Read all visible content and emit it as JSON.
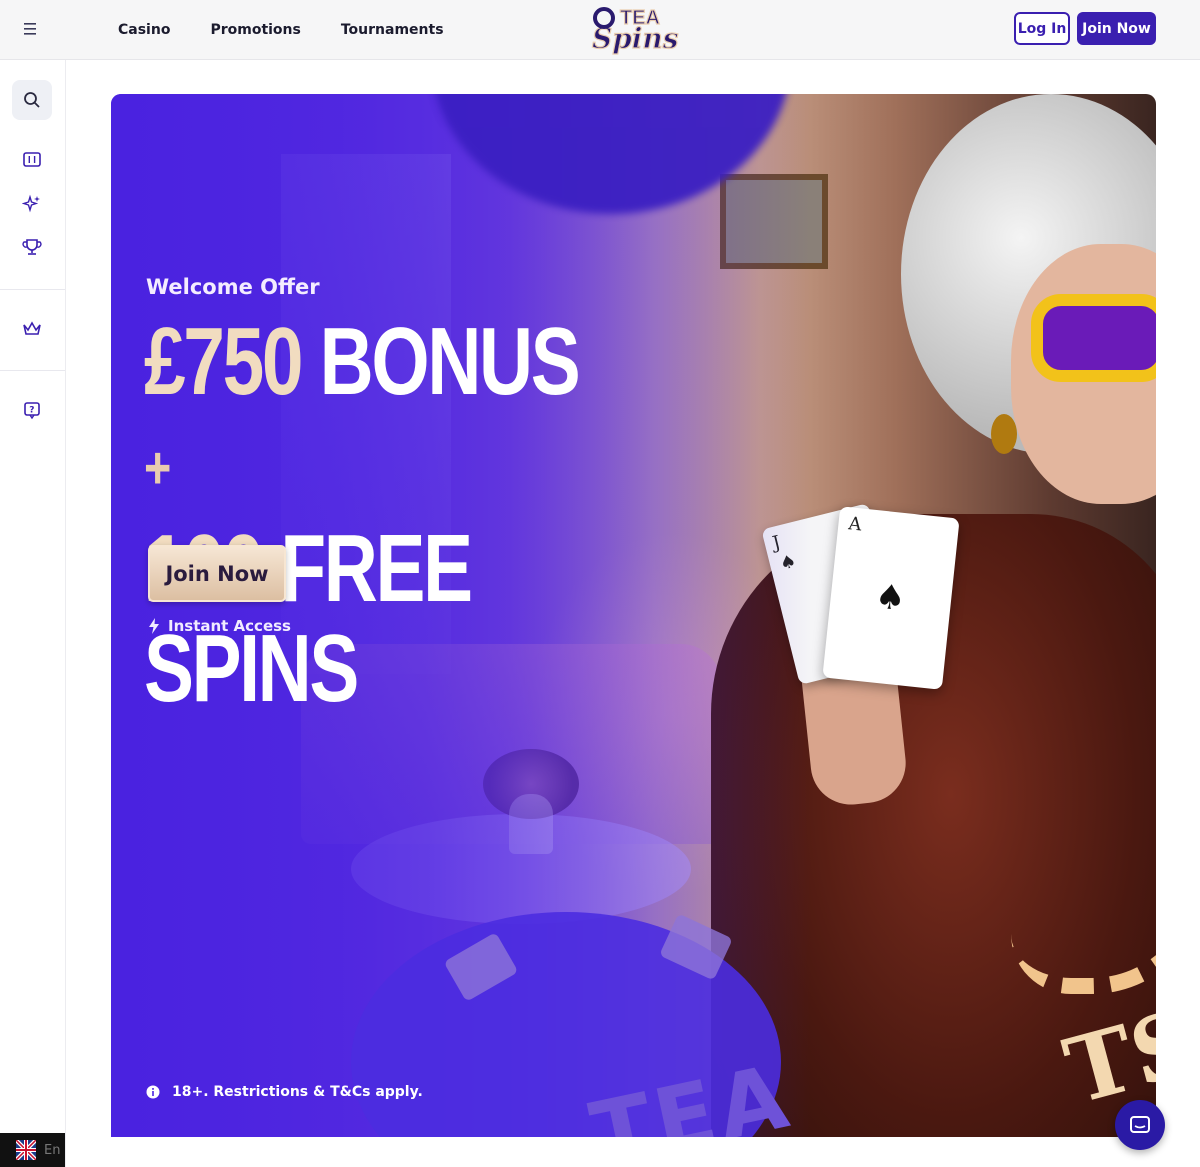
{
  "header": {
    "nav": [
      "Casino",
      "Promotions",
      "Tournaments"
    ],
    "logo_text": "TEA Spins",
    "login_label": "Log In",
    "join_label": "Join Now"
  },
  "sidebar": {
    "icons": [
      "search-icon",
      "slot-machine-icon",
      "sparkles-icon",
      "trophy-icon",
      "crown-icon",
      "help-icon"
    ],
    "language_label": "En"
  },
  "hero": {
    "eyebrow": "Welcome Offer",
    "headline_line1_amount": "£750",
    "headline_line1_text": "BONUS",
    "headline_plus": "+",
    "headline_line2_amount": "100",
    "headline_line2_text": "FREE SPINS",
    "cta_label": "Join Now",
    "instant_access": "Instant Access",
    "disclaimer": "18+. Restrictions & T&Cs apply.",
    "card_j_rank": "J",
    "card_a_rank": "A",
    "card_suit": "♠",
    "watermark_text": "TEA",
    "watermark_logo": "TS"
  },
  "colors": {
    "brand_purple": "#3a1fb0",
    "hero_purple": "#4a22e0",
    "gold_text": "#f1dcc0"
  }
}
